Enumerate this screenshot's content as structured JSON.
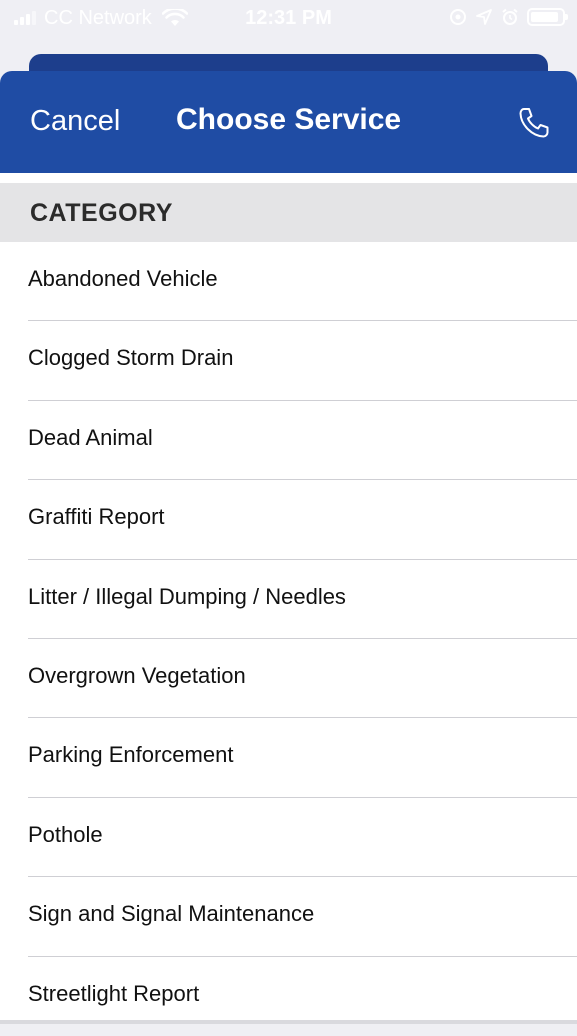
{
  "status_bar": {
    "carrier": "CC Network",
    "time": "12:31 PM",
    "icons": [
      "signal-icon",
      "wifi-icon",
      "location-lock-icon",
      "location-arrow-icon",
      "alarm-icon",
      "battery-icon"
    ]
  },
  "header": {
    "cancel_label": "Cancel",
    "title": "Choose Service",
    "phone_icon": "phone-icon"
  },
  "section": {
    "label": "CATEGORY"
  },
  "items": [
    {
      "label": "Abandoned Vehicle"
    },
    {
      "label": "Clogged Storm Drain"
    },
    {
      "label": "Dead Animal"
    },
    {
      "label": "Graffiti Report"
    },
    {
      "label": "Litter / Illegal Dumping / Needles"
    },
    {
      "label": "Overgrown Vegetation"
    },
    {
      "label": "Parking Enforcement"
    },
    {
      "label": "Pothole"
    },
    {
      "label": "Sign and Signal Maintenance"
    },
    {
      "label": "Streetlight Report"
    }
  ],
  "colors": {
    "header_blue": "#1f4ca4",
    "back_card_blue": "#1d3e8c",
    "section_gray": "#e4e4e6"
  }
}
